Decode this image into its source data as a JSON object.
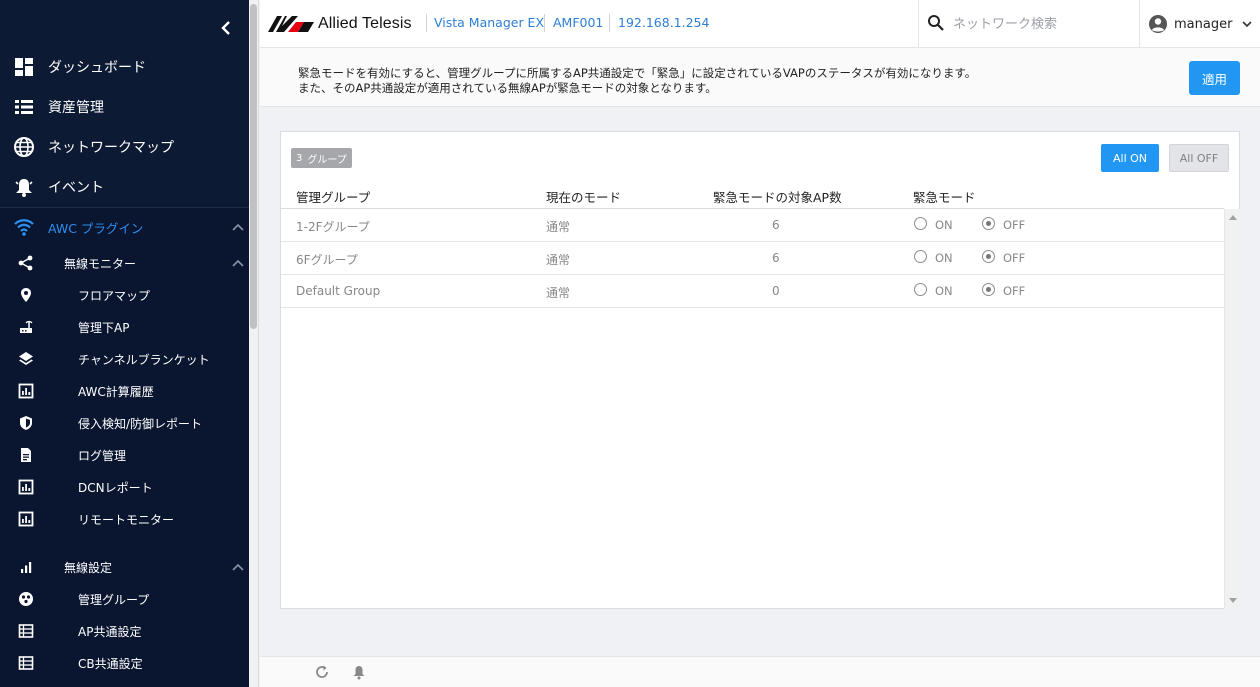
{
  "sidebar": {
    "items": [
      {
        "label": "ダッシュボード",
        "icon": "dashboard-icon"
      },
      {
        "label": "資産管理",
        "icon": "list-icon"
      },
      {
        "label": "ネットワークマップ",
        "icon": "globe-icon"
      },
      {
        "label": "イベント",
        "icon": "bell-icon"
      },
      {
        "label": "AWC プラグイン",
        "icon": "wifi-icon",
        "active": true
      },
      {
        "label": "無線モニター",
        "icon": "share-icon"
      },
      {
        "label": "フロアマップ",
        "icon": "location-pin-icon"
      },
      {
        "label": "管理下AP",
        "icon": "router-icon"
      },
      {
        "label": "チャンネルブランケット",
        "icon": "layers-icon"
      },
      {
        "label": "AWC計算履歴",
        "icon": "chart-box-icon"
      },
      {
        "label": "侵入検知/防御レポート",
        "icon": "shield-icon"
      },
      {
        "label": "ログ管理",
        "icon": "document-icon"
      },
      {
        "label": "DCNレポート",
        "icon": "chart-box-icon"
      },
      {
        "label": "リモートモニター",
        "icon": "chart-box-icon"
      },
      {
        "label": "無線設定",
        "icon": "signal-bars-icon"
      },
      {
        "label": "管理グループ",
        "icon": "group-icon"
      },
      {
        "label": "AP共通設定",
        "icon": "table-icon"
      },
      {
        "label": "CB共通設定",
        "icon": "table-icon"
      }
    ]
  },
  "header": {
    "brand": "Allied Telesis",
    "product": "Vista Manager EX",
    "device": "AMF001",
    "ip": "192.168.1.254",
    "search_placeholder": "ネットワーク検索",
    "user": "manager"
  },
  "notice": {
    "line1": "緊急モードを有効にすると、管理グループに所属するAP共通設定で「緊急」に設定されているVAPのステータスが有効になります。",
    "line2": "また、そのAP共通設定が適用されている無線APが緊急モードの対象となります。",
    "apply_label": "適用"
  },
  "panel": {
    "group_count": "3",
    "group_label": "グループ",
    "all_on_label": "All ON",
    "all_off_label": "All OFF",
    "columns": [
      "管理グループ",
      "現在のモード",
      "緊急モードの対象AP数",
      "緊急モード"
    ],
    "radio_on_label": "ON",
    "radio_off_label": "OFF",
    "rows": [
      {
        "group": "1-2Fグループ",
        "mode": "通常",
        "ap_count": "6",
        "emergency": "OFF"
      },
      {
        "group": "6Fグループ",
        "mode": "通常",
        "ap_count": "6",
        "emergency": "OFF"
      },
      {
        "group": "Default Group",
        "mode": "通常",
        "ap_count": "0",
        "emergency": "OFF"
      }
    ]
  },
  "colors": {
    "sidebar_bg": "#0c1a33",
    "accent": "#2196f3",
    "link": "#2d7fd6"
  }
}
